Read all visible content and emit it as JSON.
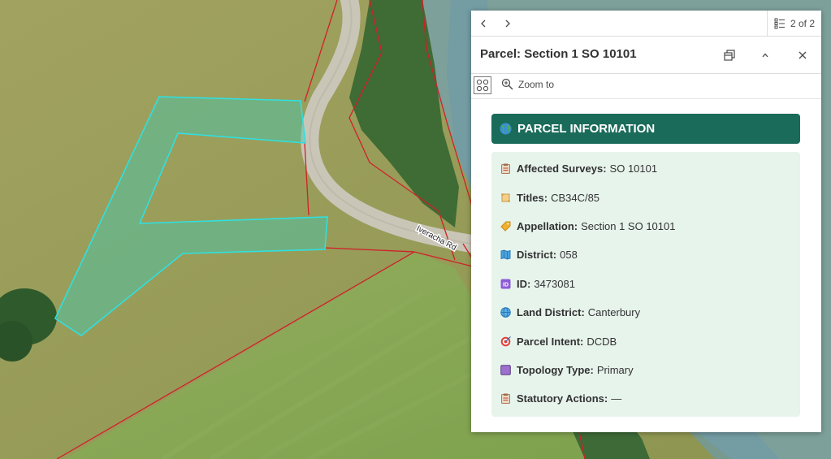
{
  "map": {
    "road_label": "Iveracha Rd",
    "colors": {
      "parcel_line": "#d0202a",
      "selection": "#30e0e0",
      "selection_fill": "#40c8b0"
    }
  },
  "popup": {
    "pager": {
      "prev_icon": "chevron-left-icon",
      "next_icon": "chevron-right-icon",
      "count": "2 of 2"
    },
    "title": "Parcel: Section 1 SO 10101",
    "toolbar": {
      "zoom_to": "Zoom to"
    },
    "section_title": "PARCEL INFORMATION",
    "colors": {
      "header_bg": "#1a6b5a",
      "info_bg": "#e7f4ec"
    },
    "fields": [
      {
        "label": "Affected Surveys:",
        "value": "SO 10101",
        "icon": "clipboard-icon"
      },
      {
        "label": "Titles:",
        "value": "CB34C/85",
        "icon": "scroll-icon"
      },
      {
        "label": "Appellation:",
        "value": "Section 1 SO 10101",
        "icon": "tag-icon"
      },
      {
        "label": "District:",
        "value": "058",
        "icon": "map-icon"
      },
      {
        "label": "ID:",
        "value": "3473081",
        "icon": "id-icon"
      },
      {
        "label": "Land District:",
        "value": "Canterbury",
        "icon": "globe-icon"
      },
      {
        "label": "Parcel Intent:",
        "value": "DCDB",
        "icon": "target-icon"
      },
      {
        "label": "Topology Type:",
        "value": "Primary",
        "icon": "square-icon"
      },
      {
        "label": "Statutory Actions:",
        "value": "—",
        "icon": "clipboard-icon"
      }
    ]
  }
}
